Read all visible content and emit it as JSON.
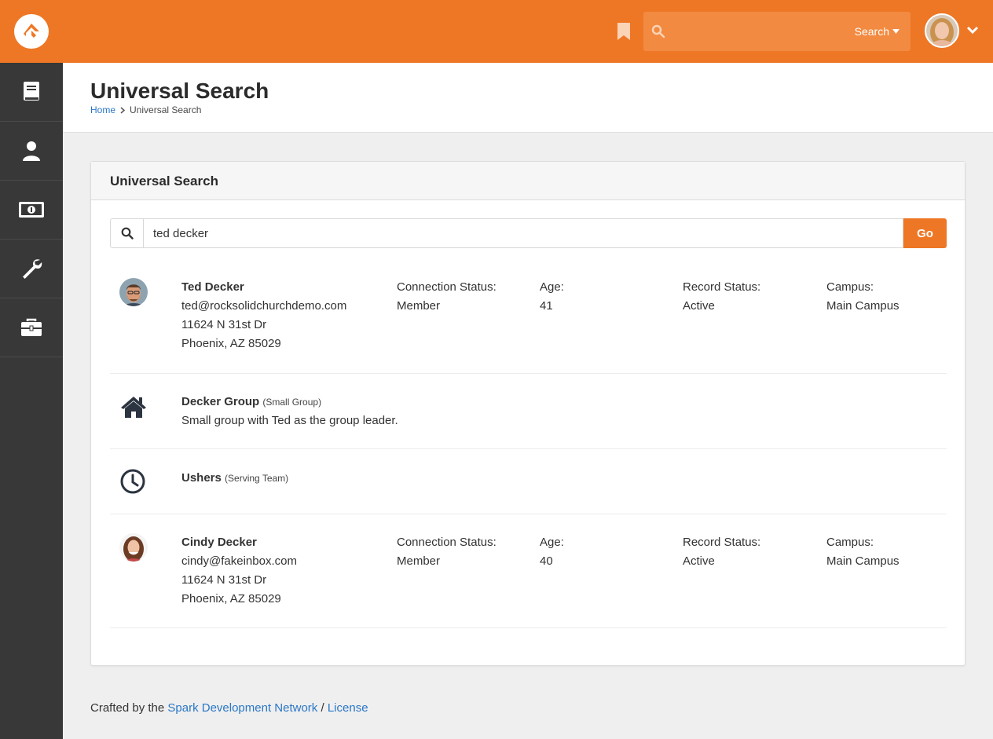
{
  "topbar": {
    "search_placeholder": "",
    "search_mode_label": "Search",
    "brand_color": "#ee7725"
  },
  "sidebar": {
    "items": [
      {
        "icon": "book-icon"
      },
      {
        "icon": "person-icon"
      },
      {
        "icon": "money-icon"
      },
      {
        "icon": "wrench-icon"
      },
      {
        "icon": "briefcase-icon"
      }
    ]
  },
  "header": {
    "title": "Universal Search",
    "breadcrumb": [
      "Home",
      "Universal Search"
    ]
  },
  "panel": {
    "title": "Universal Search",
    "search_value": "ted decker",
    "go_label": "Go"
  },
  "results": [
    {
      "type": "person",
      "name": "Ted Decker",
      "email": "ted@rocksolidchurchdemo.com",
      "address1": "11624 N 31st Dr",
      "address2": "Phoenix, AZ 85029",
      "connection_status_label": "Connection Status:",
      "connection_status": "Member",
      "age_label": "Age:",
      "age": "41",
      "record_status_label": "Record Status:",
      "record_status": "Active",
      "campus_label": "Campus:",
      "campus": "Main Campus"
    },
    {
      "type": "group",
      "icon": "home-icon",
      "name": "Decker Group",
      "group_type": "(Small Group)",
      "description": "Small group with Ted as the group leader."
    },
    {
      "type": "group",
      "icon": "clock-icon",
      "name": "Ushers",
      "group_type": "(Serving Team)"
    },
    {
      "type": "person",
      "name": "Cindy Decker",
      "email": "cindy@fakeinbox.com",
      "address1": "11624 N 31st Dr",
      "address2": "Phoenix, AZ 85029",
      "connection_status_label": "Connection Status:",
      "connection_status": "Member",
      "age_label": "Age:",
      "age": "40",
      "record_status_label": "Record Status:",
      "record_status": "Active",
      "campus_label": "Campus:",
      "campus": "Main Campus"
    }
  ],
  "footer": {
    "prefix": "Crafted by the",
    "link1": "Spark Development Network",
    "separator": "/",
    "link2": "License"
  }
}
